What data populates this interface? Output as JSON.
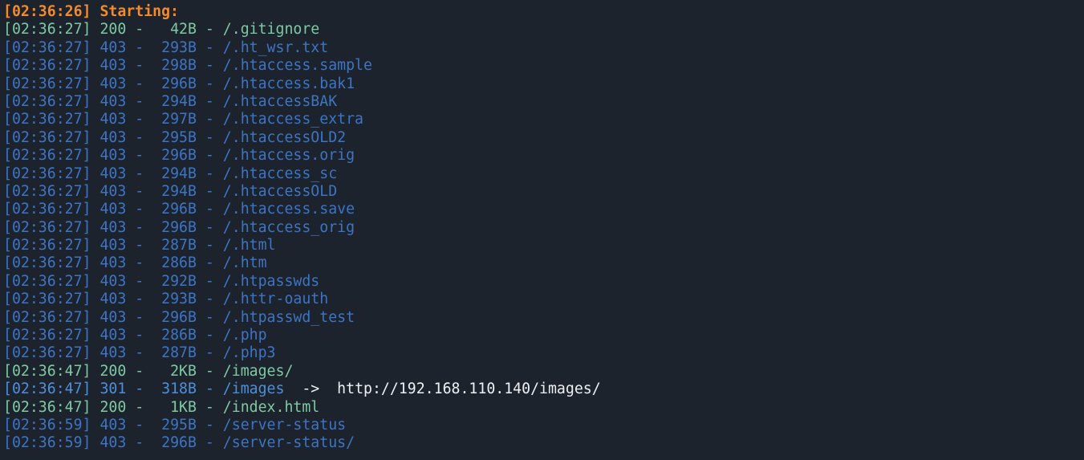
{
  "terminal": {
    "colors": {
      "background": "#1d232c",
      "start": "#f28a2e",
      "status_200": "#7ec9a4",
      "status_301": "#4f8fd8",
      "status_403": "#3d74c4",
      "url": "#eef1f4"
    },
    "start_line": "[02:36:26] Starting:",
    "entries": [
      {
        "time": "[02:36:27]",
        "status": "200",
        "size": "42B",
        "path": "/.gitignore"
      },
      {
        "time": "[02:36:27]",
        "status": "403",
        "size": "293B",
        "path": "/.ht_wsr.txt"
      },
      {
        "time": "[02:36:27]",
        "status": "403",
        "size": "298B",
        "path": "/.htaccess.sample"
      },
      {
        "time": "[02:36:27]",
        "status": "403",
        "size": "296B",
        "path": "/.htaccess.bak1"
      },
      {
        "time": "[02:36:27]",
        "status": "403",
        "size": "294B",
        "path": "/.htaccessBAK"
      },
      {
        "time": "[02:36:27]",
        "status": "403",
        "size": "297B",
        "path": "/.htaccess_extra"
      },
      {
        "time": "[02:36:27]",
        "status": "403",
        "size": "295B",
        "path": "/.htaccessOLD2"
      },
      {
        "time": "[02:36:27]",
        "status": "403",
        "size": "296B",
        "path": "/.htaccess.orig"
      },
      {
        "time": "[02:36:27]",
        "status": "403",
        "size": "294B",
        "path": "/.htaccess_sc"
      },
      {
        "time": "[02:36:27]",
        "status": "403",
        "size": "294B",
        "path": "/.htaccessOLD"
      },
      {
        "time": "[02:36:27]",
        "status": "403",
        "size": "296B",
        "path": "/.htaccess.save"
      },
      {
        "time": "[02:36:27]",
        "status": "403",
        "size": "296B",
        "path": "/.htaccess_orig"
      },
      {
        "time": "[02:36:27]",
        "status": "403",
        "size": "287B",
        "path": "/.html"
      },
      {
        "time": "[02:36:27]",
        "status": "403",
        "size": "286B",
        "path": "/.htm"
      },
      {
        "time": "[02:36:27]",
        "status": "403",
        "size": "292B",
        "path": "/.htpasswds"
      },
      {
        "time": "[02:36:27]",
        "status": "403",
        "size": "293B",
        "path": "/.httr-oauth"
      },
      {
        "time": "[02:36:27]",
        "status": "403",
        "size": "296B",
        "path": "/.htpasswd_test"
      },
      {
        "time": "[02:36:27]",
        "status": "403",
        "size": "286B",
        "path": "/.php"
      },
      {
        "time": "[02:36:27]",
        "status": "403",
        "size": "287B",
        "path": "/.php3"
      },
      {
        "time": "[02:36:47]",
        "status": "200",
        "size": "2KB",
        "path": "/images/"
      },
      {
        "time": "[02:36:47]",
        "status": "301",
        "size": "318B",
        "path": "/images",
        "arrow": "->",
        "redirect": "http://192.168.110.140/images/"
      },
      {
        "time": "[02:36:47]",
        "status": "200",
        "size": "1KB",
        "path": "/index.html"
      },
      {
        "time": "[02:36:59]",
        "status": "403",
        "size": "295B",
        "path": "/server-status"
      },
      {
        "time": "[02:36:59]",
        "status": "403",
        "size": "296B",
        "path": "/server-status/"
      }
    ]
  }
}
